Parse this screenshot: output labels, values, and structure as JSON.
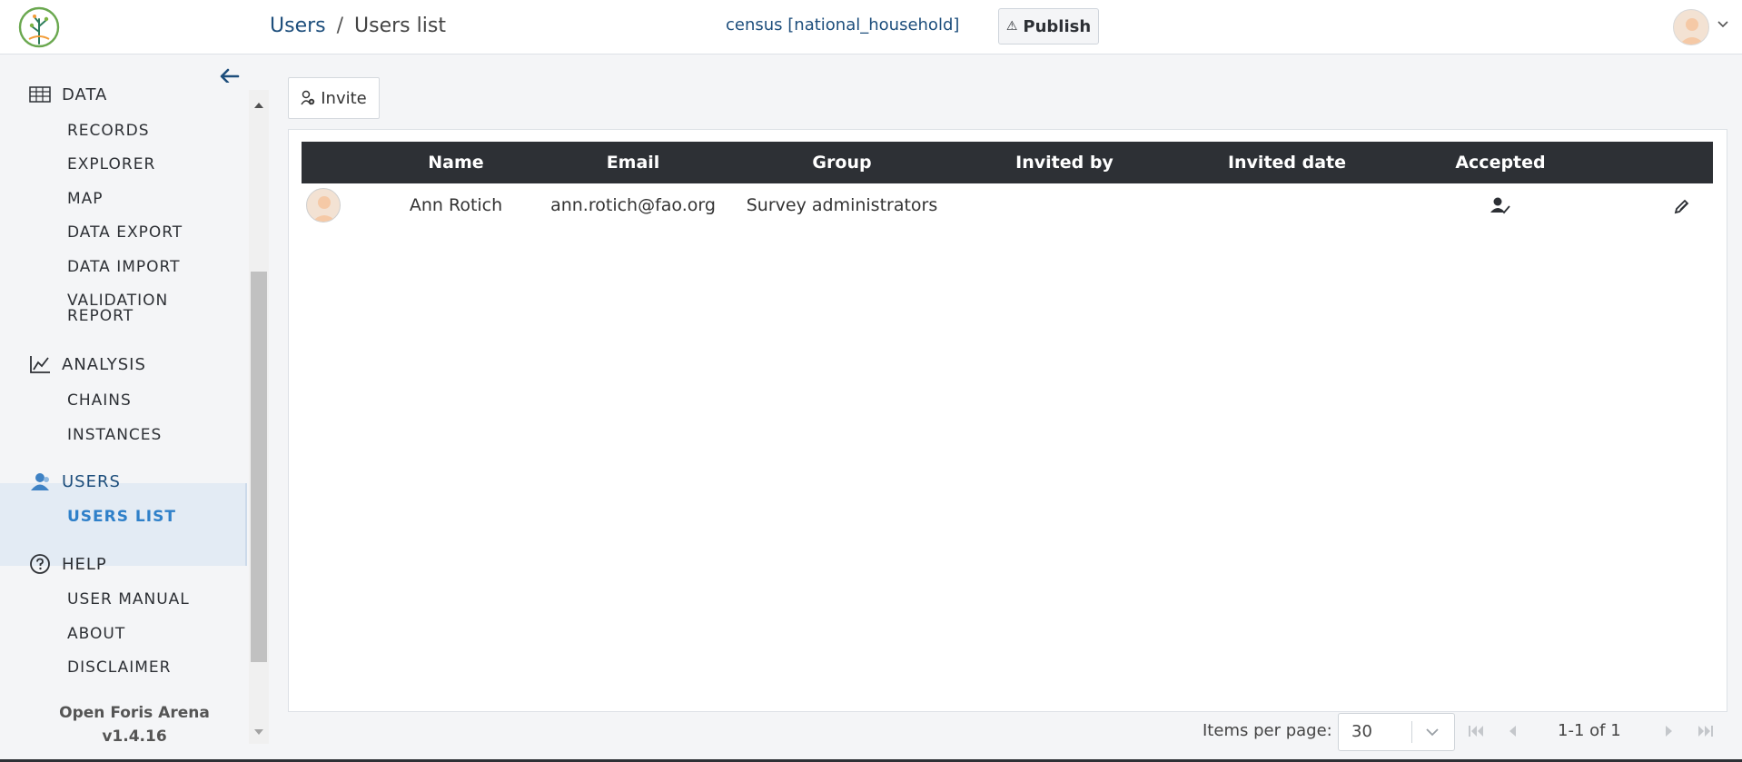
{
  "header": {
    "breadcrumb_parent": "Users",
    "breadcrumb_sep": "/",
    "breadcrumb_current": "Users list",
    "survey_name": "census [national_household]",
    "publish_label": "Publish",
    "publish_icon": "⚠"
  },
  "sidebar": {
    "modules": [
      {
        "label": "DATA",
        "icon": "table-grid-icon",
        "items": [
          "RECORDS",
          "EXPLORER",
          "MAP",
          "DATA EXPORT",
          "DATA IMPORT",
          "VALIDATION REPORT"
        ]
      },
      {
        "label": "ANALYSIS",
        "icon": "line-chart-icon",
        "items": [
          "CHAINS",
          "INSTANCES"
        ]
      },
      {
        "label": "USERS",
        "icon": "users-icon",
        "items": [
          "USERS LIST"
        ],
        "active": true,
        "active_item": "USERS LIST"
      },
      {
        "label": "HELP",
        "icon": "help-circle-icon",
        "items": [
          "USER MANUAL",
          "ABOUT",
          "DISCLAIMER"
        ]
      }
    ],
    "validation_report_line1": "VALIDATION",
    "validation_report_line2": "REPORT",
    "app_name": "Open Foris Arena",
    "app_version": "v1.4.16"
  },
  "toolbar": {
    "invite_label": "Invite"
  },
  "table": {
    "columns": [
      "Name",
      "Email",
      "Group",
      "Invited by",
      "Invited date",
      "Accepted"
    ],
    "rows": [
      {
        "name": "Ann Rotich",
        "email": "ann.rotich@fao.org",
        "group": "Survey administrators",
        "invited_by": "",
        "invited_date": "",
        "accepted": true
      }
    ]
  },
  "pagination": {
    "items_per_page_label": "Items per page:",
    "items_per_page": "30",
    "range_text": "1-1 of 1"
  },
  "colors": {
    "primary": "#1d4e7c",
    "accent": "#2f80c9",
    "table_header": "#2d3035",
    "active_bg": "#e3ebf4"
  }
}
